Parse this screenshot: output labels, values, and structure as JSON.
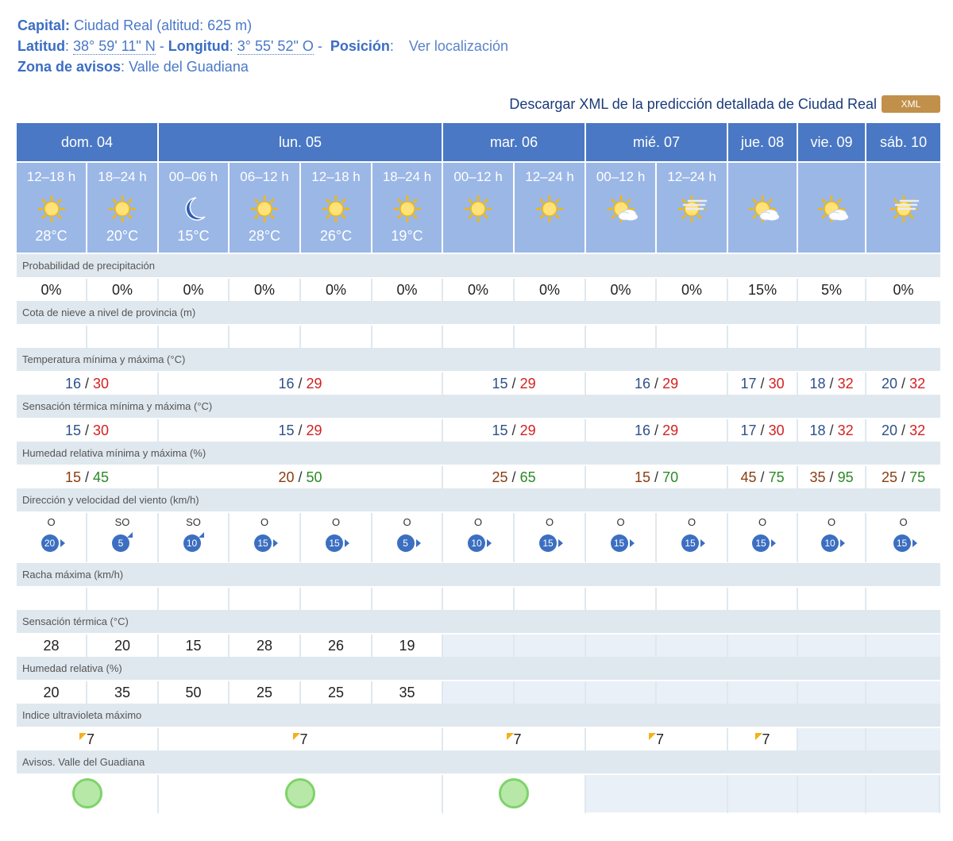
{
  "header": {
    "capital_label": "Capital:",
    "capital_value": "Ciudad Real (altitud: 625 m)",
    "lat_label": "Latitud",
    "lat_value": "38° 59' 11\" N",
    "lon_label": "Longitud",
    "lon_value": "3° 55' 52\" O",
    "pos_label": "Posición",
    "pos_link": "Ver localización",
    "zone_label": "Zona de avisos",
    "zone_value": "Valle del Guadiana"
  },
  "xml": {
    "text": "Descargar XML de la predicción detallada de Ciudad Real",
    "button": "XML"
  },
  "days": [
    "dom. 04",
    "lun. 05",
    "mar. 06",
    "mié. 07",
    "jue. 08",
    "vie. 09",
    "sáb. 10"
  ],
  "slots": [
    {
      "time": "12–18 h",
      "icon": "sun",
      "temp": "28°C"
    },
    {
      "time": "18–24 h",
      "icon": "sun",
      "temp": "20°C"
    },
    {
      "time": "00–06 h",
      "icon": "moon",
      "temp": "15°C"
    },
    {
      "time": "06–12 h",
      "icon": "sun",
      "temp": "28°C"
    },
    {
      "time": "12–18 h",
      "icon": "sun",
      "temp": "26°C"
    },
    {
      "time": "18–24 h",
      "icon": "sun",
      "temp": "19°C"
    },
    {
      "time": "00–12 h",
      "icon": "sun",
      "temp": ""
    },
    {
      "time": "12–24 h",
      "icon": "sun",
      "temp": ""
    },
    {
      "time": "00–12 h",
      "icon": "sun-cloud",
      "temp": ""
    },
    {
      "time": "12–24 h",
      "icon": "sun-haze",
      "temp": ""
    },
    {
      "time": "",
      "icon": "sun-cloud",
      "temp": ""
    },
    {
      "time": "",
      "icon": "sun-cloud",
      "temp": ""
    },
    {
      "time": "",
      "icon": "sun-haze",
      "temp": ""
    }
  ],
  "labels": {
    "precip": "Probabilidad de precipitación",
    "snow": "Cota de nieve a nivel de provincia (m)",
    "temp": "Temperatura mínima y máxima (°C)",
    "feels": "Sensación térmica mínima y máxima (°C)",
    "hum": "Humedad relativa mínima y máxima (%)",
    "wind": "Dirección y velocidad del viento (km/h)",
    "gust": "Racha máxima (km/h)",
    "feels_slot": "Sensación térmica (°C)",
    "hum_slot": "Humedad relativa (%)",
    "uv": "Indice ultravioleta máximo",
    "avisos": "Avisos. Valle del Guadiana"
  },
  "precip": [
    "0%",
    "0%",
    "0%",
    "0%",
    "0%",
    "0%",
    "0%",
    "0%",
    "0%",
    "0%",
    "15%",
    "5%",
    "0%"
  ],
  "temp": [
    [
      "16",
      "30"
    ],
    [
      "16",
      "29"
    ],
    [
      "15",
      "29"
    ],
    [
      "16",
      "29"
    ],
    [
      "17",
      "30"
    ],
    [
      "18",
      "32"
    ],
    [
      "20",
      "32"
    ]
  ],
  "feels": [
    [
      "15",
      "30"
    ],
    [
      "15",
      "29"
    ],
    [
      "15",
      "29"
    ],
    [
      "16",
      "29"
    ],
    [
      "17",
      "30"
    ],
    [
      "18",
      "32"
    ],
    [
      "20",
      "32"
    ]
  ],
  "hum": [
    [
      "15",
      "45"
    ],
    [
      "20",
      "50"
    ],
    [
      "25",
      "65"
    ],
    [
      "15",
      "70"
    ],
    [
      "45",
      "75"
    ],
    [
      "35",
      "95"
    ],
    [
      "25",
      "75"
    ]
  ],
  "wind": [
    {
      "dir": "O",
      "speed": "20",
      "arrow": "east"
    },
    {
      "dir": "SO",
      "speed": "5",
      "arrow": "northeast"
    },
    {
      "dir": "SO",
      "speed": "10",
      "arrow": "northeast"
    },
    {
      "dir": "O",
      "speed": "15",
      "arrow": "east"
    },
    {
      "dir": "O",
      "speed": "15",
      "arrow": "east"
    },
    {
      "dir": "O",
      "speed": "5",
      "arrow": "east"
    },
    {
      "dir": "O",
      "speed": "10",
      "arrow": "east"
    },
    {
      "dir": "O",
      "speed": "15",
      "arrow": "east"
    },
    {
      "dir": "O",
      "speed": "15",
      "arrow": "east"
    },
    {
      "dir": "O",
      "speed": "15",
      "arrow": "east"
    },
    {
      "dir": "O",
      "speed": "15",
      "arrow": "east"
    },
    {
      "dir": "O",
      "speed": "10",
      "arrow": "east"
    },
    {
      "dir": "O",
      "speed": "15",
      "arrow": "east"
    }
  ],
  "feels_slot": [
    "28",
    "20",
    "15",
    "28",
    "26",
    "19"
  ],
  "hum_slot": [
    "20",
    "35",
    "50",
    "25",
    "25",
    "35"
  ],
  "uv": [
    "7",
    "7",
    "7",
    "7",
    "7"
  ],
  "colors": {
    "header_blue": "#4a78c4",
    "slot_blue": "#9bb7e6",
    "min": "#2e5189",
    "max": "#d42020",
    "warn_green": "#7ed36a"
  }
}
